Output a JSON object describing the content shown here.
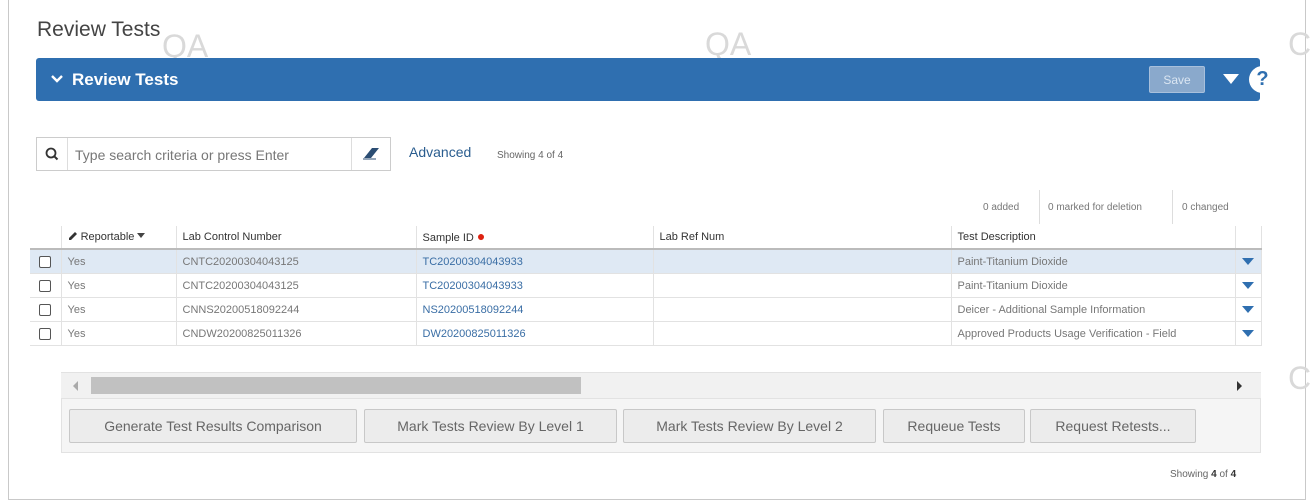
{
  "page": {
    "title": "Review Tests"
  },
  "watermark": {
    "text": "QA",
    "partial": "C"
  },
  "panel": {
    "title": "Review Tests",
    "save_label": "Save",
    "icons": [
      "chevron-down-icon",
      "caret-down-icon",
      "help-icon"
    ],
    "help_glyph": "?"
  },
  "search": {
    "placeholder": "Type search criteria or press Enter",
    "value": "",
    "advanced_label": "Advanced",
    "showing_text": "Showing 4 of 4"
  },
  "counters": {
    "added": "0 added",
    "marked_for_deletion": "0 marked for deletion",
    "changed": "0 changed"
  },
  "grid": {
    "columns": {
      "reportable": "Reportable",
      "lab_control_number": "Lab Control Number",
      "sample_id": "Sample ID",
      "lab_ref_num": "Lab Ref Num",
      "test_description": "Test Description"
    },
    "rows": [
      {
        "reportable": "Yes",
        "lab_control_number": "CNTC20200304043125",
        "sample_id": "TC20200304043933",
        "lab_ref_num": "",
        "test_description": "Paint-Titanium Dioxide",
        "selected": true
      },
      {
        "reportable": "Yes",
        "lab_control_number": "CNTC20200304043125",
        "sample_id": "TC20200304043933",
        "lab_ref_num": "",
        "test_description": "Paint-Titanium Dioxide",
        "selected": false
      },
      {
        "reportable": "Yes",
        "lab_control_number": "CNNS20200518092244",
        "sample_id": "NS20200518092244",
        "lab_ref_num": "",
        "test_description": "Deicer - Additional Sample Information",
        "selected": false
      },
      {
        "reportable": "Yes",
        "lab_control_number": "CNDW20200825011326",
        "sample_id": "DW20200825011326",
        "lab_ref_num": "",
        "test_description": "Approved Products Usage Verification - Field",
        "selected": false
      }
    ]
  },
  "actions": {
    "generate": "Generate Test Results Comparison",
    "level1": "Mark Tests Review By Level 1",
    "level2": "Mark Tests Review By Level 2",
    "requeue": "Requeue Tests",
    "retests": "Request Retests..."
  },
  "footer": {
    "showing_prefix": "Showing",
    "showing_count": "4",
    "showing_of": "of",
    "showing_total": "4"
  },
  "colors": {
    "header_blue": "#2f6fb0",
    "row_selected": "#dfe9f4",
    "link": "#3a6ea5",
    "required": "#dd2211"
  }
}
